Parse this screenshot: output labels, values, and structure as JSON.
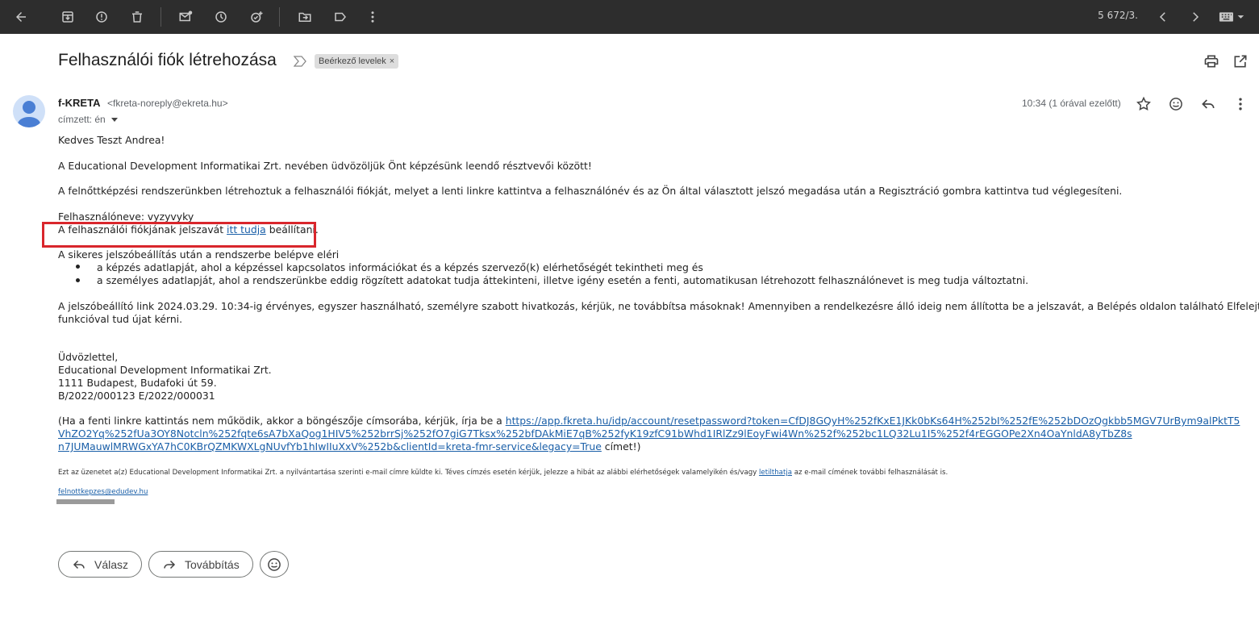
{
  "toolbar": {
    "counter": "5 672/3.",
    "icons": [
      "back-arrow-icon",
      "archive-icon",
      "report-spam-icon",
      "delete-icon",
      "mark-unread-icon",
      "snooze-icon",
      "add-task-icon",
      "move-to-icon",
      "label-icon",
      "more-vert-icon",
      "prev-icon",
      "next-icon",
      "keyboard-icon"
    ]
  },
  "email": {
    "subject": "Felhasználói fiók létrehozása",
    "label": "Beérkező levelek",
    "label_close": "×",
    "sender_name": "f-KRETA",
    "sender_email": "<fkreta-noreply@ekreta.hu>",
    "to": "címzett: én",
    "time": "10:34 (1 órával ezelőtt)"
  },
  "body": {
    "greeting": "Kedves Teszt Andrea!",
    "welcome": "A Educational Development Informatikai Zrt. nevében üdvözöljük Önt képzésünk leendő résztvevői között!",
    "account_info": "A felnőttképzési rendszerünkben létrehoztuk a felhasználói fiókját, melyet a lenti linkre kattintva a felhasználónév és az Ön által választott jelszó megadása után a Regisztráció gombra kattintva tud véglegesíteni.",
    "username": "Felhasználóneve: vyzyvyky",
    "password_pre": "A felhasználói fiókjának jelszavát ",
    "password_link": "itt tudja",
    "password_post": " beállítani.",
    "access_intro": "A sikeres jelszóbeállítás után a rendszerbe belépve eléri",
    "bullets": [
      "a képzés adatlapját, ahol a képzéssel kapcsolatos információkat és a képzés szervező(k) elérhetőségét tekintheti meg és",
      "a személyes adatlapját, ahol a rendszerünkbe eddig rögzített adatokat tudja áttekinteni, illetve igény esetén a fenti, automatikusan létrehozott felhasználónevet is meg tudja változtatni."
    ],
    "validity_1": "A jelszóbeállító link 2024.03.29. 10:34-ig érvényes, egyszer használható, személyre szabott hivatkozás, kérjük, ne továbbítsa másoknak! Amennyiben a rendelkezésre álló ideig nem állította be a jelszavát, a Belépés oldalon található Elfelejtett jelszó",
    "validity_2": "funkcióval tud újat kérni.",
    "signature": [
      "Üdvözlettel,",
      "Educational Development Informatikai Zrt.",
      "1111 Budapest, Budafoki út 59.",
      "B/2022/000123 E/2022/000031"
    ],
    "fallback_pre": "(Ha a fenti linkre kattintás nem működik, akkor a böngészője címsorába, kérjük, írja be a ",
    "fallback_url_1": "https://app.fkreta.hu/idp/account/resetpassword?token=CfDJ8GQyH%252fKxE1JKk0bKs64H%252bI%252fE%252bDOzQgkbb5MGV7UrBym9alPktT5",
    "fallback_url_2": "VhZO2Yq%252fUa3OY8Notcln%252fqte6sA7bXaQog1HIV5%252brrSj%252fO7giG7Tksx%252bfDAkMiE7qB%252fyK19zfC91bWhd1IRlZz9lEoyFwi4Wn%252f%252bc1LQ32Lu1I5%252f4rEGGOPe2Xn4OaYnldA8yTbZ8s",
    "fallback_url_3": "n7JUMauwlMRWGxYA7hC0KBrQZMKWXLgNUvfYb1hIwIIuXxV%252b&clientId=kreta-fmr-service&legacy=True",
    "fallback_post": " címet!)",
    "footer_pre": "Ezt az üzenetet a(z) Educational Development Informatikai Zrt. a nyilvántartása szerinti e-mail címre küldte ki. Téves címzés esetén kérjük, jelezze a hibát az alábbi elérhetőségek valamelyikén és/vagy ",
    "footer_link": "letilthatja",
    "footer_post": " az e-mail címének további felhasználását is.",
    "contact_email": "felnottkepzes@edudev.hu"
  },
  "actions": {
    "reply": "Válasz",
    "forward": "Továbbítás"
  },
  "colors": {
    "toolbar_bg": "#2d2d2d",
    "link": "#1a5fa8",
    "highlight": "#d9262c"
  }
}
